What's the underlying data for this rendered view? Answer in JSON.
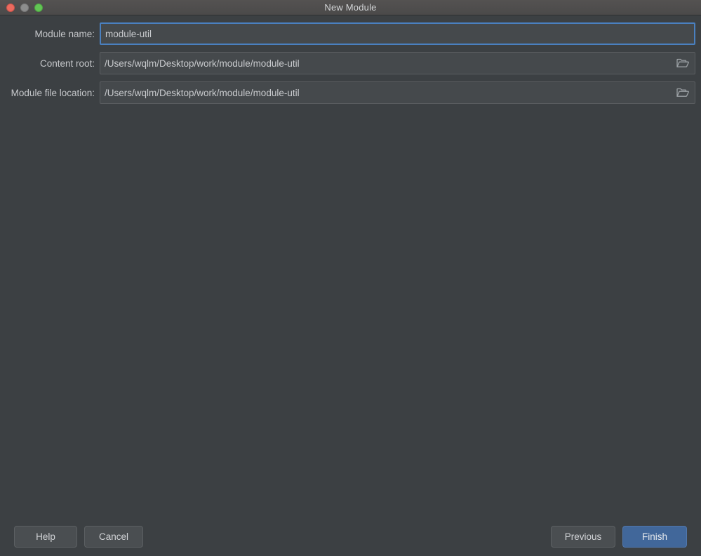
{
  "window": {
    "title": "New Module",
    "traffic_lights": [
      {
        "name": "close-button",
        "color": "#ed6a5e"
      },
      {
        "name": "minimize-button",
        "color": "#8d8d8d"
      },
      {
        "name": "zoom-button",
        "color": "#62c554"
      }
    ]
  },
  "form": {
    "rows": [
      {
        "label": "Module name:",
        "value": "module-util",
        "placeholder": "",
        "focused": true,
        "has_browse": false,
        "browse_icon": "folder-icon"
      },
      {
        "label": "Content root:",
        "value": "/Users/wqlm/Desktop/work/module/module-util",
        "placeholder": "",
        "focused": false,
        "has_browse": true,
        "browse_icon": "folder-icon"
      },
      {
        "label": "Module file location:",
        "value": "/Users/wqlm/Desktop/work/module/module-util",
        "placeholder": "",
        "focused": false,
        "has_browse": true,
        "browse_icon": "folder-icon"
      }
    ]
  },
  "buttons": {
    "help": "Help",
    "cancel": "Cancel",
    "previous": "Previous",
    "finish": "Finish"
  },
  "colors": {
    "window_bg": "#3c4043",
    "titlebar_bg": "#4b4a4a",
    "field_bg": "#45494c",
    "field_border": "#5a5d60",
    "focus_border": "#4a80c0",
    "text": "#c6c8cb",
    "button_bg": "#4a4e51",
    "primary_button_bg": "#41679a"
  }
}
